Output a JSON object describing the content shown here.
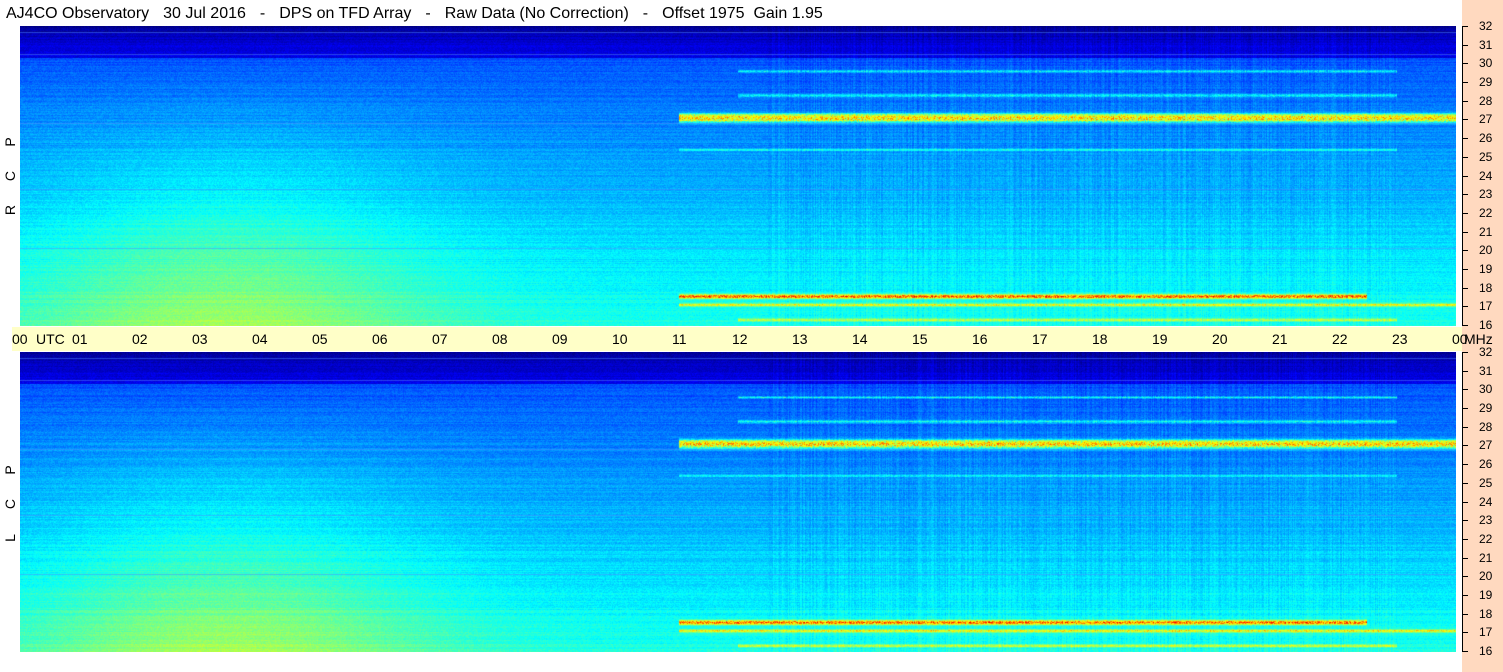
{
  "header": {
    "station": "AJ4CO Observatory",
    "date": "30 Jul 2016",
    "instrument": "DPS on TFD Array",
    "mode": "Raw Data (No Correction)",
    "offset_gain": "Offset 1975  Gain 1.95"
  },
  "panels": {
    "top": {
      "pol_letters": [
        "R",
        "C",
        "P"
      ]
    },
    "bottom": {
      "pol_letters": [
        "L",
        "C",
        "P"
      ]
    }
  },
  "time_axis": {
    "labels": [
      "00",
      "UTC",
      "01",
      "02",
      "03",
      "04",
      "05",
      "06",
      "07",
      "08",
      "09",
      "10",
      "11",
      "12",
      "13",
      "14",
      "15",
      "16",
      "17",
      "18",
      "19",
      "20",
      "21",
      "22",
      "23",
      "00",
      "MHz"
    ]
  },
  "freq_axis": {
    "labels": [
      "32",
      "31",
      "30",
      "29",
      "28",
      "27",
      "26",
      "25",
      "24",
      "23",
      "22",
      "21",
      "20",
      "19",
      "18",
      "17",
      "16"
    ]
  },
  "colors": {
    "background": "#ffffff",
    "time_band": "#ffffc8",
    "freq_band": "#ffd9bf"
  },
  "chart_data": {
    "type": "heatmap",
    "title": "AJ4CO Observatory  30 Jul 2016  -  DPS on TFD Array  -  Raw Data (No Correction)  -  Offset 1975  Gain 1.95",
    "xlabel": "UTC",
    "ylabel": "MHz",
    "x_range": [
      "00",
      "24"
    ],
    "y_range": [
      16,
      32
    ],
    "colormap": "jet",
    "panels": [
      {
        "name": "R C P"
      },
      {
        "name": "L C P"
      }
    ]
  }
}
